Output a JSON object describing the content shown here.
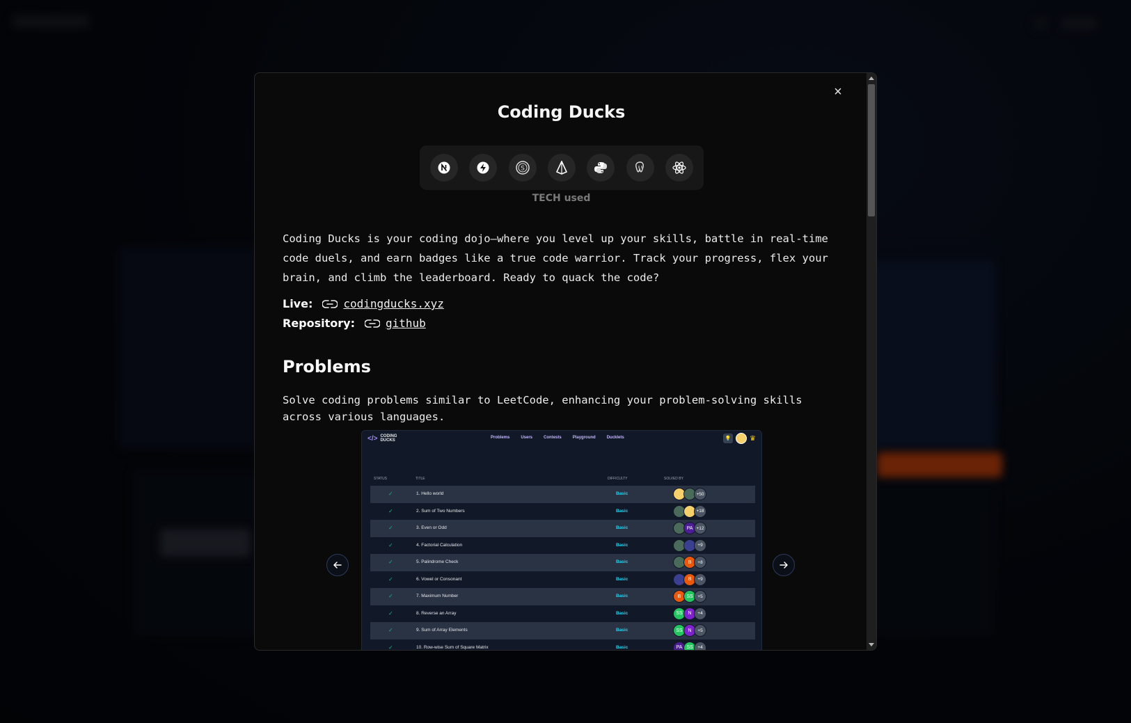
{
  "modal": {
    "title": "Coding Ducks",
    "close_symbol": "×",
    "tech_label": "TECH used",
    "tech_icons": [
      "nextjs-icon",
      "supabase-icon",
      "socketio-icon",
      "prisma-icon",
      "python-icon",
      "postgresql-icon",
      "react-icon"
    ],
    "description": "Coding Ducks is your coding dojo—where you level up your skills, battle in real-time code duels, and earn badges like a true code warrior. Track your progress, flex your brain, and climb the leaderboard. Ready to quack the code?",
    "live_label": "Live:",
    "live_link": "codingducks.xyz",
    "repo_label": "Repository:",
    "repo_link": "github",
    "section_title": "Problems",
    "section_desc": "Solve coding problems similar to LeetCode, enhancing your problem-solving skills across various languages."
  },
  "screenshot": {
    "logo_text": "CODING DUCKS",
    "nav": [
      "Problems",
      "Users",
      "Contests",
      "Playground",
      "Ducklets"
    ],
    "columns": [
      "STATUS",
      "TITLE",
      "DIFFICULTY",
      "SOLVED BY"
    ],
    "rows": [
      {
        "title": "1. Hello world",
        "difficulty": "Basic",
        "avatars": [
          {
            "t": "",
            "c": "#f5d06b"
          },
          {
            "t": "",
            "c": "#4b6b5a"
          }
        ],
        "more": "+50"
      },
      {
        "title": "2. Sum of Two Numbers",
        "difficulty": "Basic",
        "avatars": [
          {
            "t": "",
            "c": "#4b6b5a"
          },
          {
            "t": "",
            "c": "#f5d06b"
          }
        ],
        "more": "+18"
      },
      {
        "title": "3. Even or Odd",
        "difficulty": "Basic",
        "avatars": [
          {
            "t": "",
            "c": "#4b6b5a"
          },
          {
            "t": "PA",
            "c": "#4c1d95"
          }
        ],
        "more": "+12"
      },
      {
        "title": "4. Factorial Calculation",
        "difficulty": "Basic",
        "avatars": [
          {
            "t": "",
            "c": "#4b6b5a"
          },
          {
            "t": "",
            "c": "#3b3f8f"
          }
        ],
        "more": "+9"
      },
      {
        "title": "5. Palindrome Check",
        "difficulty": "Basic",
        "avatars": [
          {
            "t": "",
            "c": "#4b6b5a"
          },
          {
            "t": "B",
            "c": "#ea580c"
          }
        ],
        "more": "+8"
      },
      {
        "title": "6. Vowel or Consonant",
        "difficulty": "Basic",
        "avatars": [
          {
            "t": "",
            "c": "#3b3f8f"
          },
          {
            "t": "B",
            "c": "#ea580c"
          }
        ],
        "more": "+9"
      },
      {
        "title": "7. Maximum Number",
        "difficulty": "Basic",
        "avatars": [
          {
            "t": "B",
            "c": "#ea580c"
          },
          {
            "t": "SS",
            "c": "#22c55e"
          }
        ],
        "more": "+5"
      },
      {
        "title": "8. Reverse an Array",
        "difficulty": "Basic",
        "avatars": [
          {
            "t": "SS",
            "c": "#22c55e"
          },
          {
            "t": "N",
            "c": "#7e22ce"
          }
        ],
        "more": "+4"
      },
      {
        "title": "9. Sum of Array Elements",
        "difficulty": "Basic",
        "avatars": [
          {
            "t": "SS",
            "c": "#22c55e"
          },
          {
            "t": "N",
            "c": "#7e22ce"
          }
        ],
        "more": "+5"
      },
      {
        "title": "10. Row-wise Sum of Square Matrix",
        "difficulty": "Basic",
        "avatars": [
          {
            "t": "PA",
            "c": "#4c1d95"
          },
          {
            "t": "SS",
            "c": "#22c55e"
          }
        ],
        "more": "+4"
      }
    ]
  }
}
